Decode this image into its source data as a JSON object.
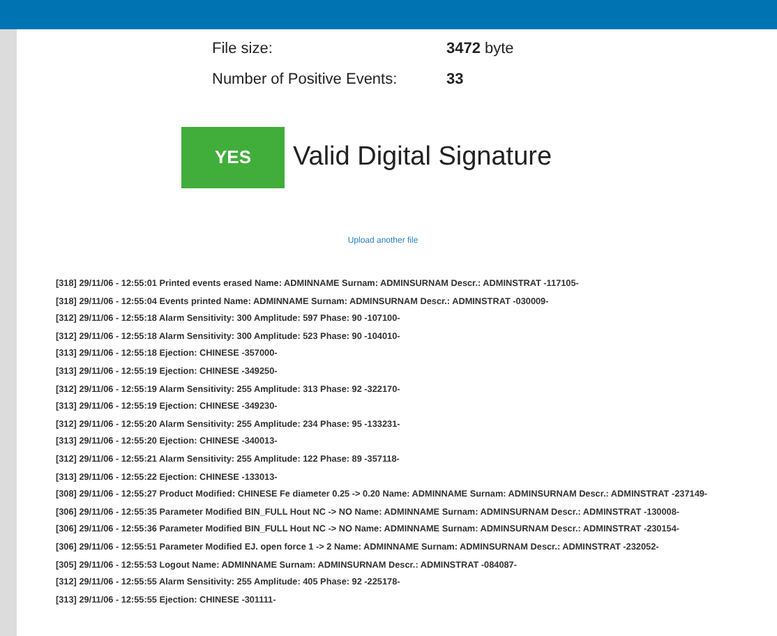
{
  "file_info": [
    {
      "label": "File size:",
      "value": "3472",
      "unit": "byte"
    },
    {
      "label": "Number of Positive Events:",
      "value": "33"
    }
  ],
  "signature": {
    "badge": "YES",
    "text": "Valid Digital Signature",
    "valid": true
  },
  "upload_link": "Upload another file",
  "log": [
    "[318] 29/11/06 - 12:55:01 Printed events erased Name: ADMINNAME Surnam: ADMINSURNAM Descr.: ADMINSTRAT -117105-",
    "[318] 29/11/06 - 12:55:04 Events printed Name: ADMINNAME Surnam: ADMINSURNAM Descr.: ADMINSTRAT -030009-",
    "[312] 29/11/06 - 12:55:18 Alarm Sensitivity: 300 Amplitude: 597 Phase: 90 -107100-",
    "[312] 29/11/06 - 12:55:18 Alarm Sensitivity: 300 Amplitude: 523 Phase: 90 -104010-",
    "[313] 29/11/06 - 12:55:18 Ejection: CHINESE -357000-",
    "[313] 29/11/06 - 12:55:19 Ejection: CHINESE -349250-",
    "[312] 29/11/06 - 12:55:19 Alarm Sensitivity: 255 Amplitude: 313 Phase: 92 -322170-",
    "[313] 29/11/06 - 12:55:19 Ejection: CHINESE -349230-",
    "[312] 29/11/06 - 12:55:20 Alarm Sensitivity: 255 Amplitude: 234 Phase: 95 -133231-",
    "[313] 29/11/06 - 12:55:20 Ejection: CHINESE -340013-",
    "[312] 29/11/06 - 12:55:21 Alarm Sensitivity: 255 Amplitude: 122 Phase: 89 -357118-",
    "[313] 29/11/06 - 12:55:22 Ejection: CHINESE -133013-",
    "[308] 29/11/06 - 12:55:27 Product Modified: CHINESE Fe diameter 0.25 -> 0.20 Name: ADMINNAME Surnam: ADMINSURNAM Descr.: ADMINSTRAT -237149-",
    "[306] 29/11/06 - 12:55:35 Parameter Modified BIN_FULL Hout NC -> NO Name: ADMINNAME Surnam: ADMINSURNAM Descr.: ADMINSTRAT -130008-",
    "[306] 29/11/06 - 12:55:36 Parameter Modified BIN_FULL Hout NC -> NO Name: ADMINNAME Surnam: ADMINSURNAM Descr.: ADMINSTRAT -230154-",
    "[306] 29/11/06 - 12:55:51 Parameter Modified EJ. open force 1 -> 2 Name: ADMINNAME Surnam: ADMINSURNAM Descr.: ADMINSTRAT -232052-",
    "[305] 29/11/06 - 12:55:53 Logout Name: ADMINNAME Surnam: ADMINSURNAM Descr.: ADMINSTRAT -084087-",
    "[312] 29/11/06 - 12:55:55 Alarm Sensitivity: 255 Amplitude: 405 Phase: 92 -225178-",
    "[313] 29/11/06 - 12:55:55 Ejection: CHINESE -301111-"
  ]
}
